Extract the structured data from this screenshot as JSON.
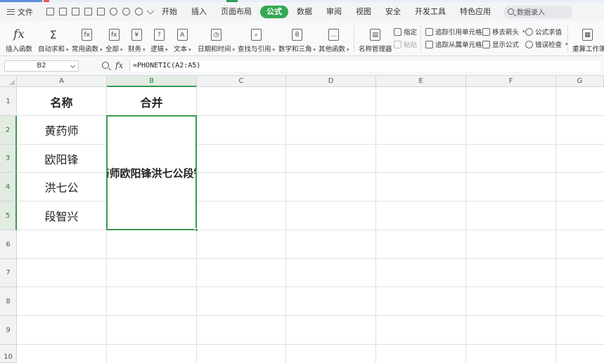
{
  "menubar": {
    "file_label": "文件",
    "tabs": [
      "开始",
      "插入",
      "页面布局",
      "公式",
      "数据",
      "审阅",
      "视图",
      "安全",
      "开发工具",
      "特色应用"
    ],
    "active_tab": "公式",
    "search_placeholder": "数据录入"
  },
  "ribbon": {
    "insert_function": "插入函数",
    "autosum": "自动求和",
    "common_functions": "常用函数",
    "all": "全部",
    "financial": "财务",
    "logical": "逻辑",
    "text": "文本",
    "datetime": "日期和时间",
    "lookup": "查找与引用",
    "math": "数学和三角",
    "other": "其他函数",
    "name_manager": "名称管理器",
    "specify": "指定",
    "paste": "粘贴",
    "trace_precedents": "追踪引用单元格",
    "trace_dependents": "追踪从属单元格",
    "remove_arrows": "移去箭头",
    "show_formulas": "显示公式",
    "evaluate_formula": "公式求值",
    "error_check": "错误检查",
    "recalc": "重算工作簿"
  },
  "formula_bar": {
    "cell_ref": "B2",
    "fx": "fx",
    "formula": "=PHONETIC(A2:A5)"
  },
  "grid": {
    "columns": [
      "A",
      "B",
      "C",
      "D",
      "E",
      "F",
      "G"
    ],
    "rows": [
      "1",
      "2",
      "3",
      "4",
      "5",
      "6",
      "7",
      "8",
      "9",
      "10"
    ],
    "selected_column": "B",
    "a1": "名称",
    "b1": "合并",
    "a2": "黄药师",
    "a3": "欧阳锋",
    "a4": "洪七公",
    "a5": "段智兴",
    "merged_b2_b5": "黄药师欧阳锋洪七公段智兴"
  },
  "colors": {
    "accent": "#34a853",
    "selection": "#3a9a50"
  }
}
